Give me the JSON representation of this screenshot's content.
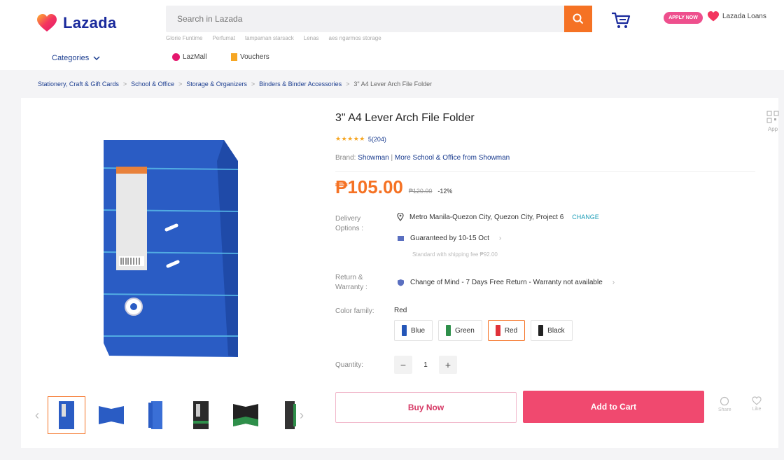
{
  "header": {
    "logo_text": "Lazada",
    "search_placeholder": "Search in Lazada",
    "search_hints": [
      "Glorie Funtime",
      "Perfumat",
      "tampaman starsack",
      "Lenas",
      "aes ngarmos storage"
    ],
    "apply_badge": "APPLY NOW",
    "loans_label": "Lazada Loans",
    "categories_label": "Categories",
    "lazmall_label": "LazMall",
    "vouchers_label": "Vouchers"
  },
  "breadcrumb": [
    "Stationery, Craft & Gift Cards",
    "School & Office",
    "Storage & Organizers",
    "Binders & Binder Accessories",
    "3\" A4 Lever Arch File Folder"
  ],
  "product": {
    "title": "3\" A4 Lever Arch File Folder",
    "rating_stars": "★★★★★",
    "rating_text": "5(204)",
    "brand_label": "Brand:",
    "brand_name": "Showman",
    "brand_more": "More School & Office from Showman",
    "price": "₱105.00",
    "original_price": "₱120.00",
    "discount": "-12%"
  },
  "delivery": {
    "label": "Delivery Options :",
    "location": "Metro Manila-Quezon City, Quezon City, Project 6",
    "change_label": "CHANGE",
    "guarantee": "Guaranteed by 10-15 Oct",
    "shipping_note": "Standard with shipping fee ₱92.00"
  },
  "return": {
    "label": "Return & Warranty :",
    "text": "Change of Mind - 7 Days Free Return - Warranty not available"
  },
  "color": {
    "label": "Color family:",
    "selected": "Red",
    "options": [
      {
        "name": "Blue",
        "color": "#2456b8"
      },
      {
        "name": "Green",
        "color": "#2e8f4a"
      },
      {
        "name": "Red",
        "color": "#e0323a"
      },
      {
        "name": "Black",
        "color": "#222222"
      }
    ]
  },
  "quantity": {
    "label": "Quantity:",
    "value": "1",
    "minus": "−",
    "plus": "+"
  },
  "actions": {
    "buy_now": "Buy Now",
    "add_to_cart": "Add to Cart",
    "share": "Share",
    "like": "Like"
  },
  "aside": {
    "qr_label": "App"
  },
  "colors": {
    "accent_orange": "#f57224",
    "cart_pink": "#f0496f",
    "brand_blue": "#1a2a9c",
    "binder_blue": "#2a5cc4"
  }
}
